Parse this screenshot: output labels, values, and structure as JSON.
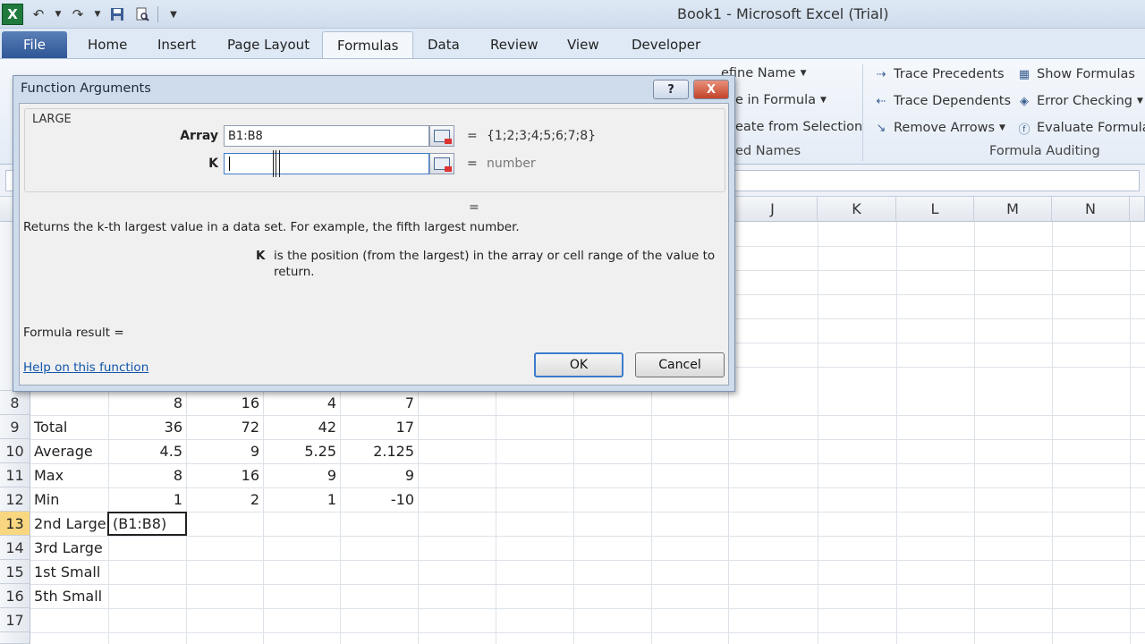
{
  "window": {
    "title": "Book1  -  Microsoft Excel (Trial)"
  },
  "quick_access": {
    "logo": "X"
  },
  "ribbon_tabs": [
    {
      "label": "File"
    },
    {
      "label": "Home"
    },
    {
      "label": "Insert"
    },
    {
      "label": "Page Layout"
    },
    {
      "label": "Formulas"
    },
    {
      "label": "Data"
    },
    {
      "label": "Review"
    },
    {
      "label": "View"
    },
    {
      "label": "Developer"
    }
  ],
  "ribbon": {
    "defined_names": {
      "define_name": "efine Name",
      "use_in_formula": "e in Formula",
      "create_from_selection": "eate from Selection",
      "group_label": "ed Names"
    },
    "formula_auditing": {
      "trace_precedents": "Trace Precedents",
      "trace_dependents": "Trace Dependents",
      "remove_arrows": "Remove Arrows",
      "show_formulas": "Show Formulas",
      "error_checking": "Error Checking",
      "evaluate_formula": "Evaluate Formula",
      "group_label": "Formula Auditing"
    }
  },
  "columns": [
    "J",
    "K",
    "L",
    "M",
    "N"
  ],
  "rows": [
    {
      "num": "8",
      "label": "",
      "b": "8",
      "c": "16",
      "d": "4",
      "e": "7"
    },
    {
      "num": "9",
      "label": "Total",
      "b": "36",
      "c": "72",
      "d": "42",
      "e": "17"
    },
    {
      "num": "10",
      "label": "Average",
      "b": "4.5",
      "c": "9",
      "d": "5.25",
      "e": "2.125"
    },
    {
      "num": "11",
      "label": "Max",
      "b": "8",
      "c": "16",
      "d": "9",
      "e": "9"
    },
    {
      "num": "12",
      "label": "Min",
      "b": "1",
      "c": "2",
      "d": "1",
      "e": "-10"
    },
    {
      "num": "13",
      "label": "2nd Large",
      "b": "(B1:B8)",
      "c": "",
      "d": "",
      "e": ""
    },
    {
      "num": "14",
      "label": "3rd Large",
      "b": "",
      "c": "",
      "d": "",
      "e": ""
    },
    {
      "num": "15",
      "label": "1st Small",
      "b": "",
      "c": "",
      "d": "",
      "e": ""
    },
    {
      "num": "16",
      "label": "5th Small",
      "b": "",
      "c": "",
      "d": "",
      "e": ""
    },
    {
      "num": "17",
      "label": "",
      "b": "",
      "c": "",
      "d": "",
      "e": ""
    }
  ],
  "dialog": {
    "title": "Function Arguments",
    "help_btn": "?",
    "close_btn": "X",
    "function_name": "LARGE",
    "array_label": "Array",
    "array_value": "B1:B8",
    "array_result": "{1;2;3;4;5;6;7;8}",
    "k_label": "K",
    "k_value": "",
    "k_result": "number",
    "equals": "=",
    "description": "Returns the k-th largest value in a data set. For example, the fifth largest number.",
    "arg_name": "K",
    "arg_desc_line1": "is the position (from the largest) in the array or cell range of the value to",
    "arg_desc_line2": "return.",
    "formula_result": "Formula result =",
    "help_link": "Help on this function",
    "ok": "OK",
    "cancel": "Cancel"
  }
}
